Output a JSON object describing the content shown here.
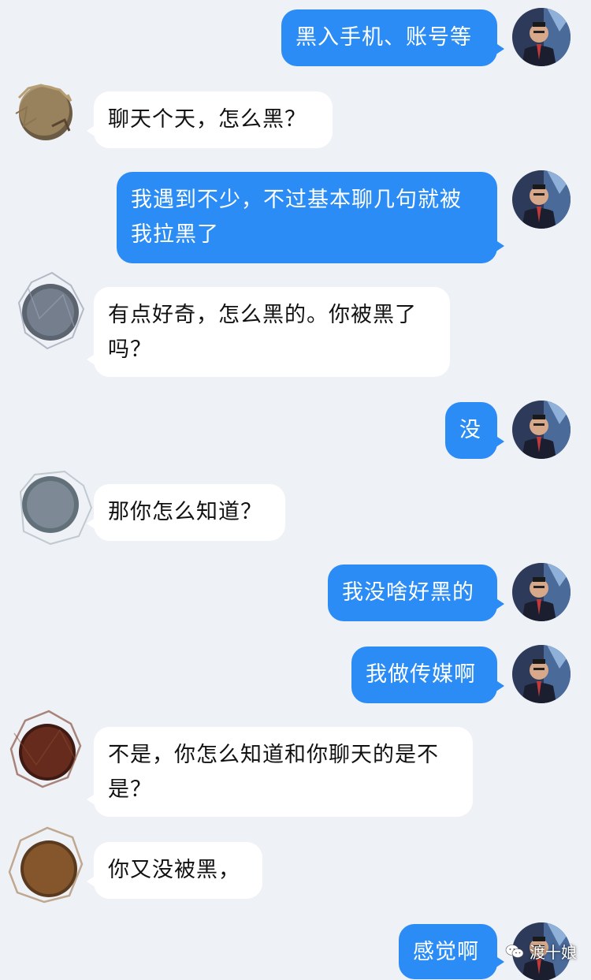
{
  "messages": [
    {
      "side": "out",
      "text": "黑入手机、账号等"
    },
    {
      "side": "in",
      "text": "聊天个天，怎么黑？",
      "avatar_color": "#9a7f57"
    },
    {
      "side": "out",
      "text": "我遇到不少，不过基本聊几句就被我拉黑了"
    },
    {
      "side": "in",
      "text": "有点好奇，怎么黑的。你被黑了吗？",
      "avatar_color": "#6a7280"
    },
    {
      "side": "out",
      "text": "没"
    },
    {
      "side": "in",
      "text": "那你怎么知道？",
      "avatar_color": "#707a84"
    },
    {
      "side": "out",
      "text": "我没啥好黑的"
    },
    {
      "side": "out",
      "text": "我做传媒啊"
    },
    {
      "side": "in",
      "text": "不是，你怎么知道和你聊天的是不是？",
      "avatar_color": "#5a2a1e"
    },
    {
      "side": "in",
      "text": "你又没被黑，",
      "avatar_color": "#7a4a26"
    },
    {
      "side": "out",
      "text": "感觉啊"
    }
  ],
  "watermark": {
    "label": "渡十娘",
    "icon": "wechat-icon"
  },
  "colors": {
    "background": "#eef1f6",
    "outgoing": "#2b8cf5",
    "incoming": "#ffffff"
  }
}
